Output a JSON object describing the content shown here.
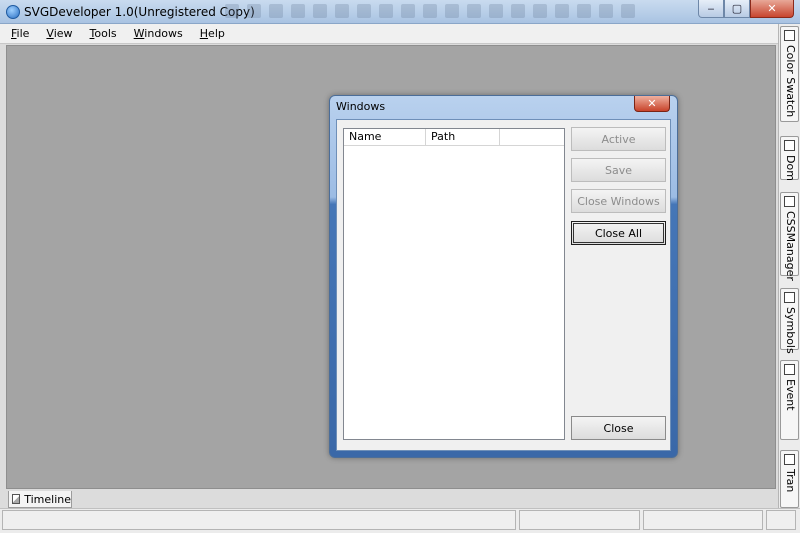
{
  "window": {
    "title": "SVGDeveloper 1.0(Unregistered Copy)",
    "controls": {
      "minimize": "‒",
      "maximize": "▢",
      "close": "✕"
    }
  },
  "menu": [
    {
      "label": "File"
    },
    {
      "label": "View"
    },
    {
      "label": "Tools"
    },
    {
      "label": "Windows"
    },
    {
      "label": "Help"
    }
  ],
  "dock_tabs": [
    {
      "label": "Color Swatch",
      "icon": "color-swatch-icon"
    },
    {
      "label": "Dom",
      "icon": "dom-icon"
    },
    {
      "label": "CSSManager",
      "icon": "css-manager-icon"
    },
    {
      "label": "Symbols",
      "icon": "symbols-icon"
    },
    {
      "label": "Event",
      "icon": "event-icon"
    },
    {
      "label": "Tran",
      "icon": "transform-icon"
    }
  ],
  "bottom_tab": {
    "label": "Timeline"
  },
  "dialog": {
    "title": "Windows",
    "close_glyph": "✕",
    "list_columns": [
      "Name",
      "Path",
      ""
    ],
    "buttons": {
      "active": "Active",
      "save": "Save",
      "close_windows": "Close Windows",
      "close_all": "Close All",
      "close": "Close"
    }
  },
  "colors": {
    "workspace": "#a4a4a4",
    "dialog_frame": "#3a68a8",
    "titlebar": "#c9dbef"
  }
}
